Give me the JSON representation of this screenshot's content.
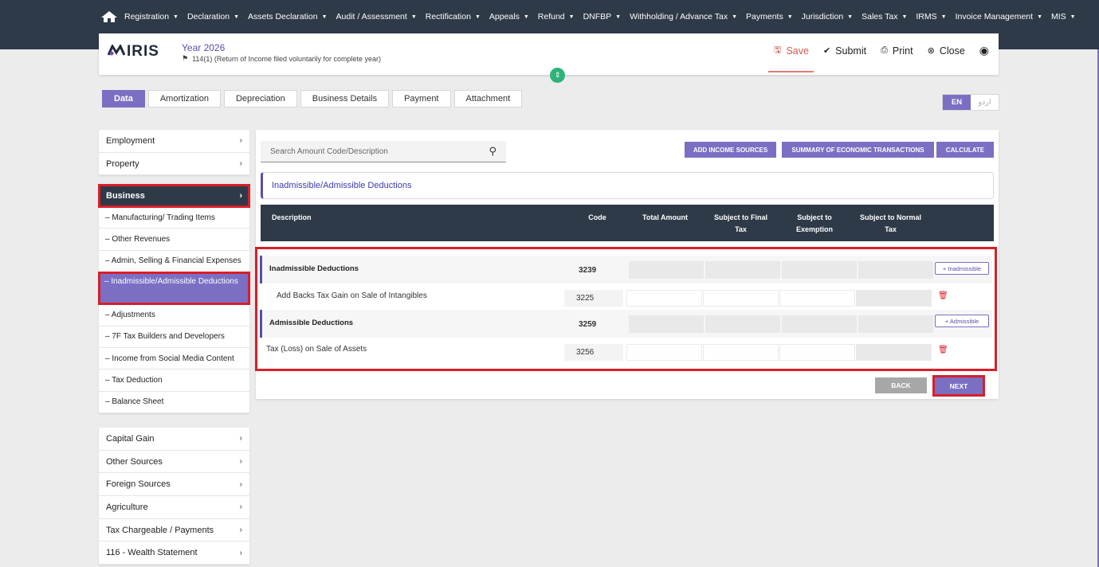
{
  "nav": {
    "items": [
      "Registration",
      "Declaration",
      "Assets Declaration",
      "Audit / Assessment",
      "Rectification",
      "Appeals",
      "Refund",
      "DNFBP",
      "Withholding / Advance Tax",
      "Payments",
      "Jurisdiction",
      "Sales Tax",
      "IRMS",
      "Invoice Management",
      "MIS"
    ],
    "home_icon": "home-icon"
  },
  "header": {
    "logo": "IRIS",
    "year": "Year 2026",
    "subtitle": "114(1) (Return of Income filed voluntarily for complete year)",
    "save": "Save",
    "submit": "Submit",
    "print": "Print",
    "close": "Close"
  },
  "tabs": [
    "Data",
    "Amortization",
    "Depreciation",
    "Business Details",
    "Payment",
    "Attachment"
  ],
  "lang": {
    "en": "EN",
    "ur": "اردو"
  },
  "sidebar": {
    "top": [
      "Employment",
      "Property"
    ],
    "business": "Business",
    "business_sub": [
      "– Manufacturing/ Trading Items",
      "– Other Revenues",
      "– Admin, Selling & Financial Expenses",
      "– Inadmissible/Admissible Deductions",
      "– Adjustments",
      "– 7F Tax Builders and Developers",
      "– Income from Social Media Content",
      "– Tax Deduction",
      "– Balance Sheet"
    ],
    "bottom": [
      "Capital Gain",
      "Other Sources",
      "Foreign Sources",
      "Agriculture",
      "Tax Chargeable / Payments",
      "116 - Wealth Statement"
    ]
  },
  "main": {
    "search_placeholder": "Search Amount Code/Description",
    "btn_add_income": "ADD INCOME SOURCES",
    "btn_summary": "SUMMARY OF ECONOMIC TRANSACTIONS",
    "btn_calculate": "CALCULATE",
    "section_title": "Inadmissible/Admissible Deductions",
    "columns": {
      "description": "Description",
      "code": "Code",
      "total": "Total Amount",
      "final": "Subject to Final Tax",
      "exemption": "Subject to Exemption",
      "normal": "Subject to Normal Tax"
    },
    "rows": [
      {
        "label": "Inadmissible Deductions",
        "code": "3239",
        "button": "+ Inadmissible"
      },
      {
        "label": "Add Backs Tax Gain on Sale of Intangibles",
        "code": "3225"
      },
      {
        "label": "Admissible Deductions",
        "code": "3259",
        "button": "+ Admissible"
      },
      {
        "label": "Tax (Loss) on Sale of Assets",
        "code": "3256"
      }
    ],
    "back": "BACK",
    "next": "NEXT"
  }
}
